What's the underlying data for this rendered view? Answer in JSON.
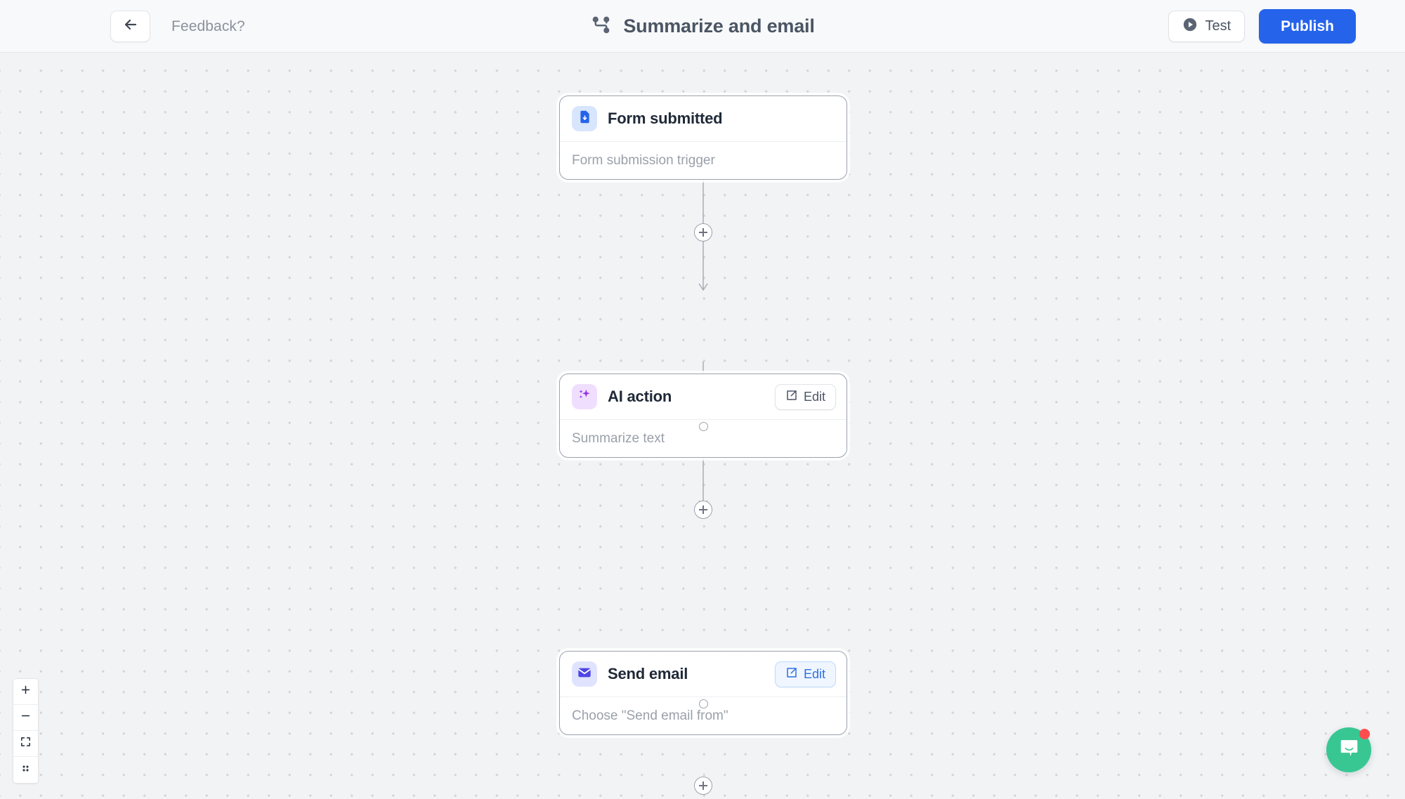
{
  "header": {
    "back_icon": "arrow-left-icon",
    "feedback_label": "Feedback?",
    "workflow_icon": "workflow-branch-icon",
    "title": "Summarize and email",
    "test_label": "Test",
    "test_icon": "play-circle-icon",
    "publish_label": "Publish",
    "publish_color": "#2563eb"
  },
  "canvas": {
    "nodes": [
      {
        "id": "form-submitted",
        "icon": "form-document-download-icon",
        "icon_color": "#2563eb",
        "icon_bg": "#d7e5fd",
        "title": "Form submitted",
        "subtitle": "Form submission trigger",
        "has_edit": false,
        "edit_label": "",
        "edit_active": false
      },
      {
        "id": "ai-action",
        "icon": "sparkles-icon",
        "icon_color": "#9333ea",
        "icon_bg": "#f0deff",
        "title": "AI action",
        "subtitle": "Summarize text",
        "has_edit": true,
        "edit_label": "Edit",
        "edit_icon": "pencil-square-icon",
        "edit_active": false
      },
      {
        "id": "send-email",
        "icon": "envelope-icon",
        "icon_color": "#4f46e5",
        "icon_bg": "#dfe3fe",
        "title": "Send email",
        "subtitle": "Choose \"Send email from\"",
        "has_edit": true,
        "edit_label": "Edit",
        "edit_icon": "pencil-square-icon",
        "edit_active": true
      }
    ],
    "zoom_controls": [
      {
        "name": "zoom-in-button",
        "icon": "plus-icon"
      },
      {
        "name": "zoom-out-button",
        "icon": "minus-icon"
      },
      {
        "name": "fit-view-button",
        "icon": "fit-screen-icon"
      },
      {
        "name": "toggle-interactivity-button",
        "icon": "grid-dots-icon"
      }
    ]
  },
  "chat": {
    "icon": "chat-bubble-icon",
    "color": "#38c793",
    "badge_color": "#ff4d4f",
    "has_unread": true
  }
}
